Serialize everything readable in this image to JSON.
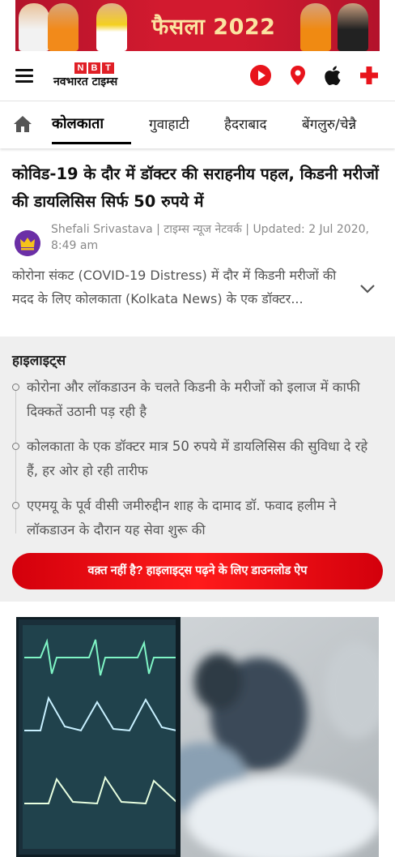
{
  "ad": {
    "text": "फैसला 2022"
  },
  "header": {
    "logo_badge": [
      "N",
      "B",
      "T"
    ],
    "logo_name": "नवभारत टाइम्स",
    "icons": [
      "hamburger-menu-icon",
      "play-icon",
      "location-pin-icon",
      "apple-icon",
      "plus-icon"
    ]
  },
  "citynav": {
    "home_icon": "home-icon",
    "items": [
      {
        "label": "कोलकाता",
        "active": true
      },
      {
        "label": "गुवाहाटी",
        "active": false
      },
      {
        "label": "हैदराबाद",
        "active": false
      },
      {
        "label": "बेंगलुरु/चेन्नै",
        "active": false
      }
    ]
  },
  "article": {
    "title": "कोविड-19 के दौर में डॉक्टर की सराहनीय पहल, किडनी मरीजों की डायलिसिस सिर्फ 50 रुपये में",
    "byline": "Shefali Srivastava | टाइम्स न्यूज नेटवर्क | Updated: 2 Jul 2020, 8:49 am",
    "summary": "कोरोना संकट (COVID-19 Distress) में दौर में किडनी मरीजों की मदद के लिए कोलकाता (Kolkata News) के एक डॉक्टर..."
  },
  "highlights": {
    "title": "हाइलाइट्स",
    "items": [
      "कोरोना और लॉकडाउन के चलते किडनी के मरीजों को इलाज में काफी दिक्कतें उठानी पड़ रही है",
      "कोलकाता के एक डॉक्टर मात्र 50 रुपये में डायलिसिस की सुविधा दे रहे हैं, हर ओर हो रही तारीफ",
      "एएमयू के पूर्व वीसी जमीरुद्दीन शाह के दामाद डॉ. फवाद हलीम ने लॉकडाउन के दौरान यह सेवा शुरू की"
    ],
    "cta": "वक़्त नहीं है? हाइलाइट्स पढ़ने के लिए डाउनलोड ऐप"
  },
  "colors": {
    "brand_red": "#e01f26",
    "cta_red": "#e8000f",
    "highlight_bg": "#efefef"
  }
}
